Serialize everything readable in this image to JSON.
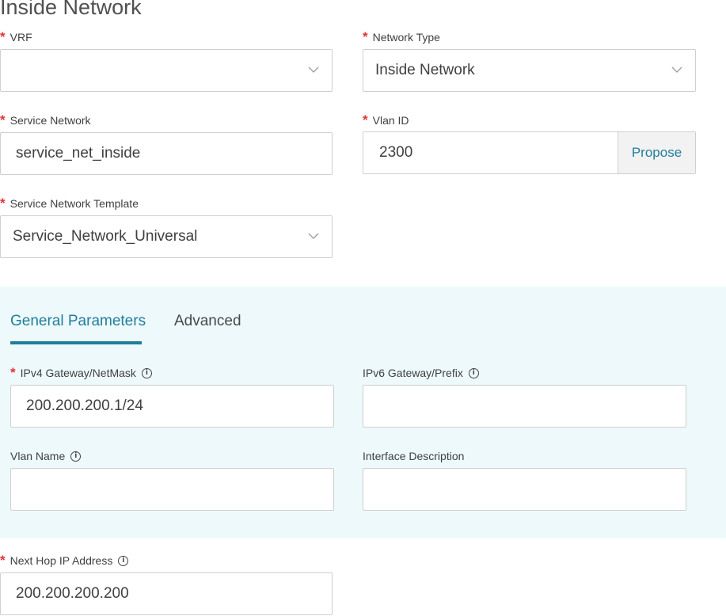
{
  "page": {
    "title": "Inside Network"
  },
  "form": {
    "vrf": {
      "label": "VRF",
      "value": ""
    },
    "network_type": {
      "label": "Network Type",
      "value": "Inside Network"
    },
    "service_network": {
      "label": "Service Network",
      "value": "service_net_inside"
    },
    "vlan_id": {
      "label": "Vlan ID",
      "value": "2300",
      "propose_label": "Propose"
    },
    "service_network_template": {
      "label": "Service Network Template",
      "value": "Service_Network_Universal"
    },
    "next_hop": {
      "label": "Next Hop IP Address",
      "value": "200.200.200.200"
    }
  },
  "tabs": [
    {
      "label": "General Parameters",
      "active": true
    },
    {
      "label": "Advanced",
      "active": false
    }
  ],
  "general": {
    "ipv4": {
      "label": "IPv4 Gateway/NetMask",
      "value": "200.200.200.1/24"
    },
    "ipv6": {
      "label": "IPv6 Gateway/Prefix",
      "value": ""
    },
    "vlan_name": {
      "label": "Vlan Name",
      "value": ""
    },
    "interface_description": {
      "label": "Interface Description",
      "value": ""
    }
  },
  "icons": {
    "required": "asterisk-icon",
    "info": "info-icon",
    "dropdown": "chevron-down-icon"
  },
  "colors": {
    "accent": "#1f7e9b",
    "required": "#e5303a",
    "panel_bg": "#eef9fb"
  }
}
